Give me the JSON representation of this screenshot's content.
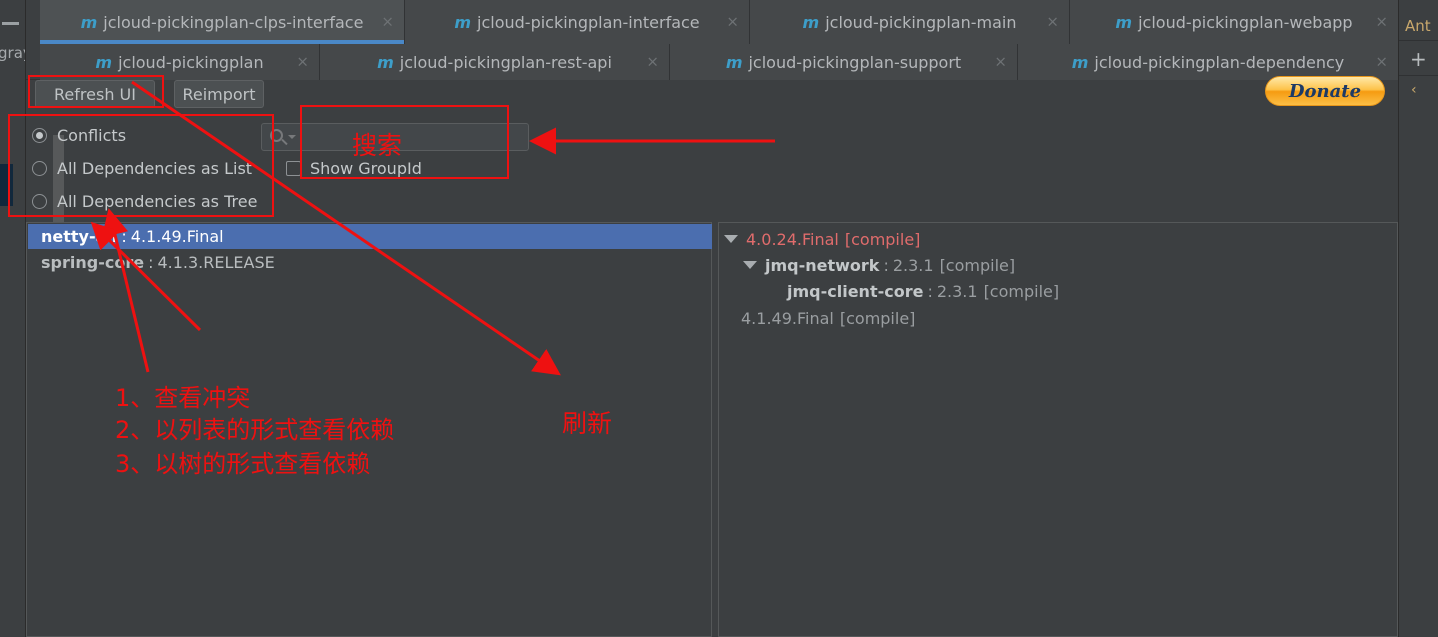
{
  "window": {
    "left_gutter_dash": "—",
    "left_gutter_text": "gray)"
  },
  "tabs_row1": [
    {
      "icon": "maven-module-icon",
      "icon_glyph": "m",
      "label": "jcloud-pickingplan-clps-interface",
      "close": "×",
      "active": true
    },
    {
      "icon": "maven-module-icon",
      "icon_glyph": "m",
      "label": "jcloud-pickingplan-interface",
      "close": "×",
      "active": false
    },
    {
      "icon": "maven-module-icon",
      "icon_glyph": "m",
      "label": "jcloud-pickingplan-main",
      "close": "×",
      "active": false
    },
    {
      "icon": "maven-module-icon",
      "icon_glyph": "m",
      "label": "jcloud-pickingplan-webapp",
      "close": "×",
      "active": false
    }
  ],
  "tabs_row2": [
    {
      "icon": "maven-module-icon",
      "icon_glyph": "m",
      "label": "jcloud-pickingplan",
      "close": "×"
    },
    {
      "icon": "maven-module-icon",
      "icon_glyph": "m",
      "label": "jcloud-pickingplan-rest-api",
      "close": "×"
    },
    {
      "icon": "maven-module-icon",
      "icon_glyph": "m",
      "label": "jcloud-pickingplan-support",
      "close": "×"
    },
    {
      "icon": "maven-module-icon",
      "icon_glyph": "m",
      "label": "jcloud-pickingplan-dependency",
      "close": "×"
    }
  ],
  "right_strip": {
    "panel_label": "Ant",
    "add_label": "+",
    "collapse_glyph": "‹"
  },
  "toolbar": {
    "refresh_label": "Refresh UI",
    "reimport_label": "Reimport",
    "donate_label": "Donate"
  },
  "options": {
    "radios": [
      {
        "label": "Conflicts",
        "selected": true
      },
      {
        "label": "All Dependencies as List",
        "selected": false
      },
      {
        "label": "All Dependencies as Tree",
        "selected": false
      }
    ],
    "search": {
      "value": "",
      "placeholder": "",
      "icon": "search-icon"
    },
    "checkbox": {
      "label": "Show GroupId",
      "checked": false
    }
  },
  "left_pane": {
    "rows": [
      {
        "name": "netty-all",
        "sep": ":",
        "version": "4.1.49.Final",
        "selected": true
      },
      {
        "name": "spring-core",
        "sep": ":",
        "version": "4.1.3.RELEASE",
        "selected": false
      }
    ]
  },
  "right_pane": {
    "rows": [
      {
        "caret": true,
        "indent": 0,
        "name": "",
        "sep": "",
        "version": "4.0.24.Final",
        "scope": "[compile]",
        "conflict": true
      },
      {
        "caret": true,
        "indent": 1,
        "name": "jmq-network",
        "sep": ":",
        "version": "2.3.1",
        "scope": "[compile]",
        "conflict": false
      },
      {
        "caret": false,
        "indent": 2,
        "name": "jmq-client-core",
        "sep": ":",
        "version": "2.3.1",
        "scope": "[compile]",
        "conflict": false
      },
      {
        "caret": false,
        "indent": 0,
        "name": "",
        "sep": "",
        "version": "4.1.49.Final",
        "scope": "[compile]",
        "conflict": false
      }
    ]
  },
  "annotations": {
    "color": "#ee1111",
    "notes": [
      "1、查看冲突",
      "2、以列表的形式查看依赖",
      "3、以树的形式查看依赖"
    ],
    "refresh_note": "刷新",
    "search_note": "搜索"
  }
}
